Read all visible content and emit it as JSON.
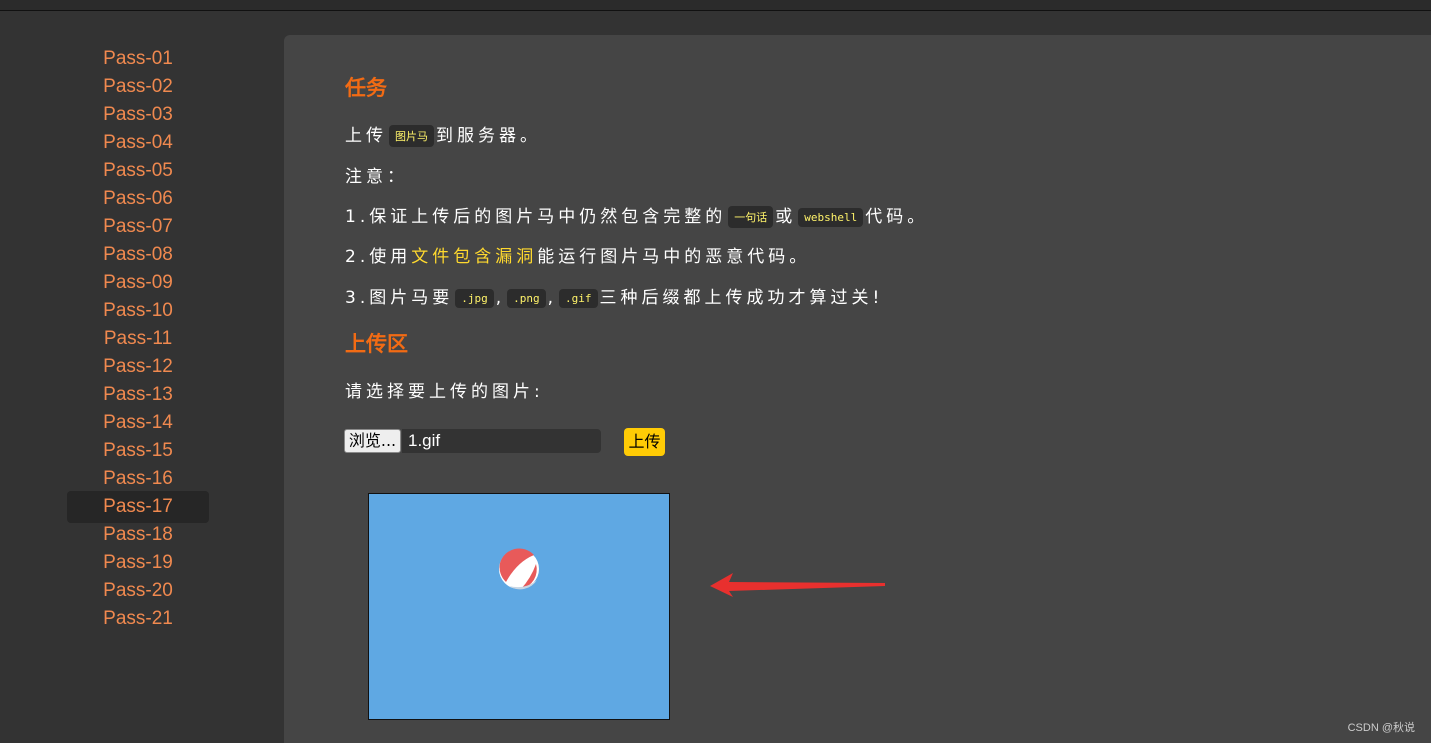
{
  "sidebar": {
    "items": [
      "Pass-01",
      "Pass-02",
      "Pass-03",
      "Pass-04",
      "Pass-05",
      "Pass-06",
      "Pass-07",
      "Pass-08",
      "Pass-09",
      "Pass-10",
      "Pass-11",
      "Pass-12",
      "Pass-13",
      "Pass-14",
      "Pass-15",
      "Pass-16",
      "Pass-17",
      "Pass-18",
      "Pass-19",
      "Pass-20",
      "Pass-21"
    ],
    "active_index": 16
  },
  "task": {
    "heading": "任务",
    "line1": {
      "pre": "上传",
      "code": "图片马",
      "post": "到服务器。"
    },
    "note": "注意：",
    "rule1": {
      "pre": "1.保证上传后的图片马中仍然包含完整的",
      "code1": "一句话",
      "mid": "或",
      "code2": "webshell",
      "post": "代码。"
    },
    "rule2": {
      "pre": "2.使用",
      "highlight": "文件包含漏洞",
      "post": "能运行图片马中的恶意代码。"
    },
    "rule3": {
      "pre": "3.图片马要",
      "code1": ".jpg",
      "sep1": ",",
      "code2": ".png",
      "sep2": ",",
      "code3": ".gif",
      "post": "三种后缀都上传成功才算过关!"
    }
  },
  "upload": {
    "heading": "上传区",
    "prompt": "请选择要上传的图片:",
    "browse_label": "浏览...",
    "file_name": "1.gif",
    "submit_label": "上传"
  },
  "watermark": "CSDN @秋说",
  "colors": {
    "accent": "#f26b14",
    "nav": "#f0894f",
    "code_text": "#fff36a",
    "button": "#ffcb05",
    "preview_bg": "#5fa8e3",
    "arrow": "#e8302e"
  }
}
